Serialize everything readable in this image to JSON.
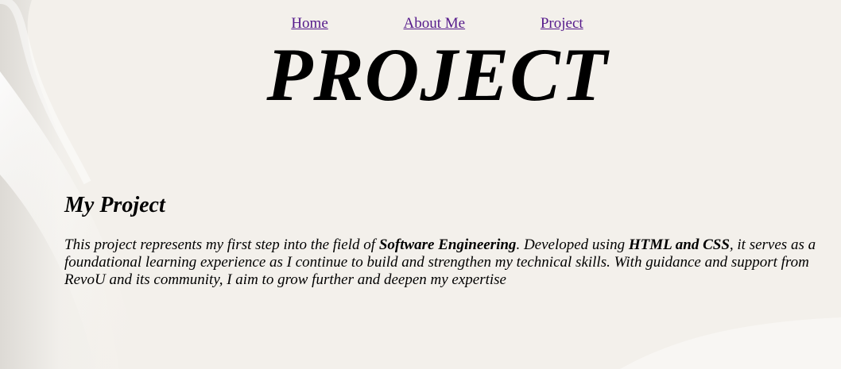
{
  "nav": {
    "items": [
      {
        "label": "Home"
      },
      {
        "label": "About Me"
      },
      {
        "label": "Project"
      }
    ]
  },
  "header": {
    "title": "PROJECT"
  },
  "main": {
    "section_title": "My Project",
    "description": {
      "part1": "This project represents my first step into the field of ",
      "bold1": "Software Engineering",
      "part2": ". Developed using ",
      "bold2": "HTML and CSS",
      "part3": ", it serves as a foundational learning experience as I continue to build and strengthen my technical skills. With guidance and support from RevoU and its community, I aim to grow further and deepen my expertise"
    }
  },
  "colors": {
    "background": "#f3f0eb",
    "link": "#551a8b",
    "text": "#000000"
  }
}
